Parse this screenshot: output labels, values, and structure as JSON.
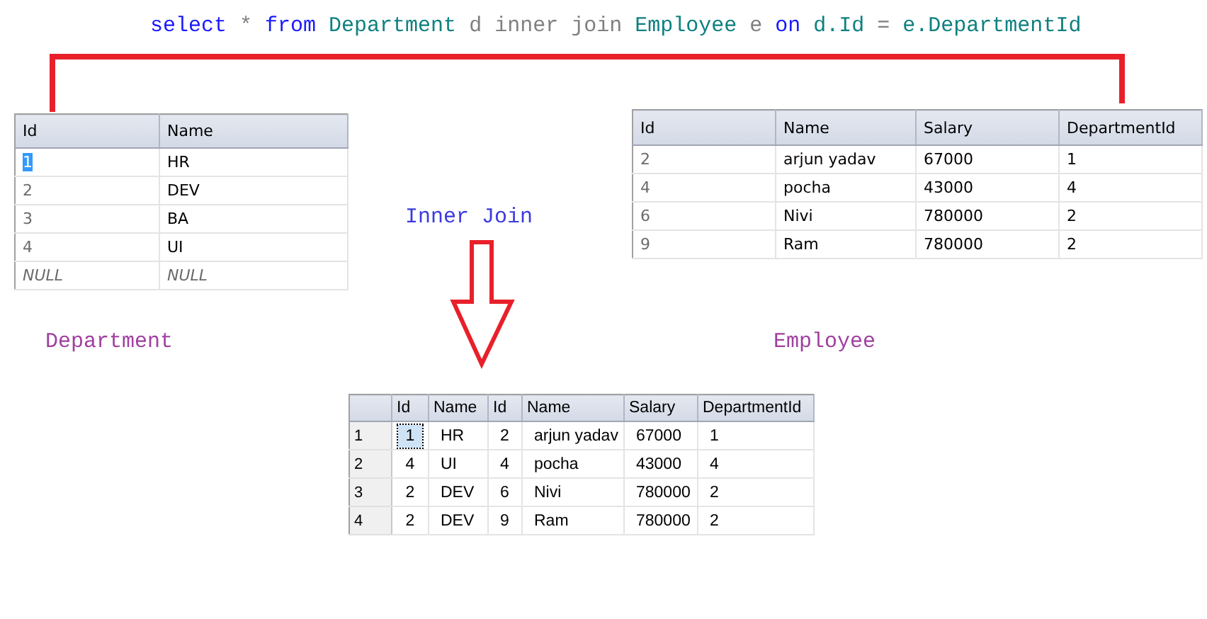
{
  "query": [
    {
      "text": "select",
      "kind": "keyword"
    },
    {
      "text": "*",
      "kind": "operator"
    },
    {
      "text": "from",
      "kind": "keyword"
    },
    {
      "text": "Department",
      "kind": "identifier"
    },
    {
      "text": "d",
      "kind": "operator"
    },
    {
      "text": "inner join",
      "kind": "operator"
    },
    {
      "text": "Employee",
      "kind": "identifier"
    },
    {
      "text": "e",
      "kind": "operator"
    },
    {
      "text": "on",
      "kind": "keyword"
    },
    {
      "text": "d.Id",
      "kind": "identifier"
    },
    {
      "text": "=",
      "kind": "operator"
    },
    {
      "text": "e.DepartmentId",
      "kind": "identifier"
    }
  ],
  "department": {
    "label": "Department",
    "columns": [
      "Id",
      "Name"
    ],
    "rows": [
      {
        "null": false,
        "cells": [
          {
            "text": "1",
            "selected": true
          },
          {
            "text": "HR",
            "selected": false
          }
        ]
      },
      {
        "null": false,
        "cells": [
          {
            "text": "2",
            "selected": false
          },
          {
            "text": "DEV",
            "selected": false
          }
        ]
      },
      {
        "null": false,
        "cells": [
          {
            "text": "3",
            "selected": false
          },
          {
            "text": "BA",
            "selected": false
          }
        ]
      },
      {
        "null": false,
        "cells": [
          {
            "text": "4",
            "selected": false
          },
          {
            "text": "UI",
            "selected": false
          }
        ]
      },
      {
        "null": true,
        "cells": [
          {
            "text": "NULL",
            "selected": false
          },
          {
            "text": "NULL",
            "selected": false
          }
        ]
      }
    ]
  },
  "employee": {
    "label": "Employee",
    "columns": [
      "Id",
      "Name",
      "Salary",
      "DepartmentId"
    ],
    "rows": [
      {
        "null": false,
        "cells": [
          {
            "text": "2",
            "selected": false
          },
          {
            "text": "arjun yadav",
            "selected": false
          },
          {
            "text": "67000",
            "selected": false
          },
          {
            "text": "1",
            "selected": false
          }
        ]
      },
      {
        "null": false,
        "cells": [
          {
            "text": "4",
            "selected": false
          },
          {
            "text": "pocha",
            "selected": false
          },
          {
            "text": "43000",
            "selected": false
          },
          {
            "text": "4",
            "selected": false
          }
        ]
      },
      {
        "null": false,
        "cells": [
          {
            "text": "6",
            "selected": false
          },
          {
            "text": "Nivi",
            "selected": false
          },
          {
            "text": "780000",
            "selected": false
          },
          {
            "text": "2",
            "selected": false
          }
        ]
      },
      {
        "null": false,
        "cells": [
          {
            "text": "9",
            "selected": false
          },
          {
            "text": "Ram",
            "selected": false
          },
          {
            "text": "780000",
            "selected": false
          },
          {
            "text": "2",
            "selected": false
          }
        ]
      }
    ]
  },
  "join_label": "Inner Join",
  "result": {
    "columns": [
      "Id",
      "Name",
      "Id",
      "Name",
      "Salary",
      "DepartmentId"
    ],
    "rows": [
      {
        "number": "1",
        "cells": [
          {
            "text": "1",
            "selected": true
          },
          {
            "text": "HR",
            "selected": false
          },
          {
            "text": "2",
            "selected": false
          },
          {
            "text": "arjun yadav",
            "selected": false
          },
          {
            "text": "67000",
            "selected": false
          },
          {
            "text": "1",
            "selected": false
          }
        ]
      },
      {
        "number": "2",
        "cells": [
          {
            "text": "4",
            "selected": false
          },
          {
            "text": "UI",
            "selected": false
          },
          {
            "text": "4",
            "selected": false
          },
          {
            "text": "pocha",
            "selected": false
          },
          {
            "text": "43000",
            "selected": false
          },
          {
            "text": "4",
            "selected": false
          }
        ]
      },
      {
        "number": "3",
        "cells": [
          {
            "text": "2",
            "selected": false
          },
          {
            "text": "DEV",
            "selected": false
          },
          {
            "text": "6",
            "selected": false
          },
          {
            "text": "Nivi",
            "selected": false
          },
          {
            "text": "780000",
            "selected": false
          },
          {
            "text": "2",
            "selected": false
          }
        ]
      },
      {
        "number": "4",
        "cells": [
          {
            "text": "2",
            "selected": false
          },
          {
            "text": "DEV",
            "selected": false
          },
          {
            "text": "9",
            "selected": false
          },
          {
            "text": "Ram",
            "selected": false
          },
          {
            "text": "780000",
            "selected": false
          },
          {
            "text": "2",
            "selected": false
          }
        ]
      }
    ]
  }
}
